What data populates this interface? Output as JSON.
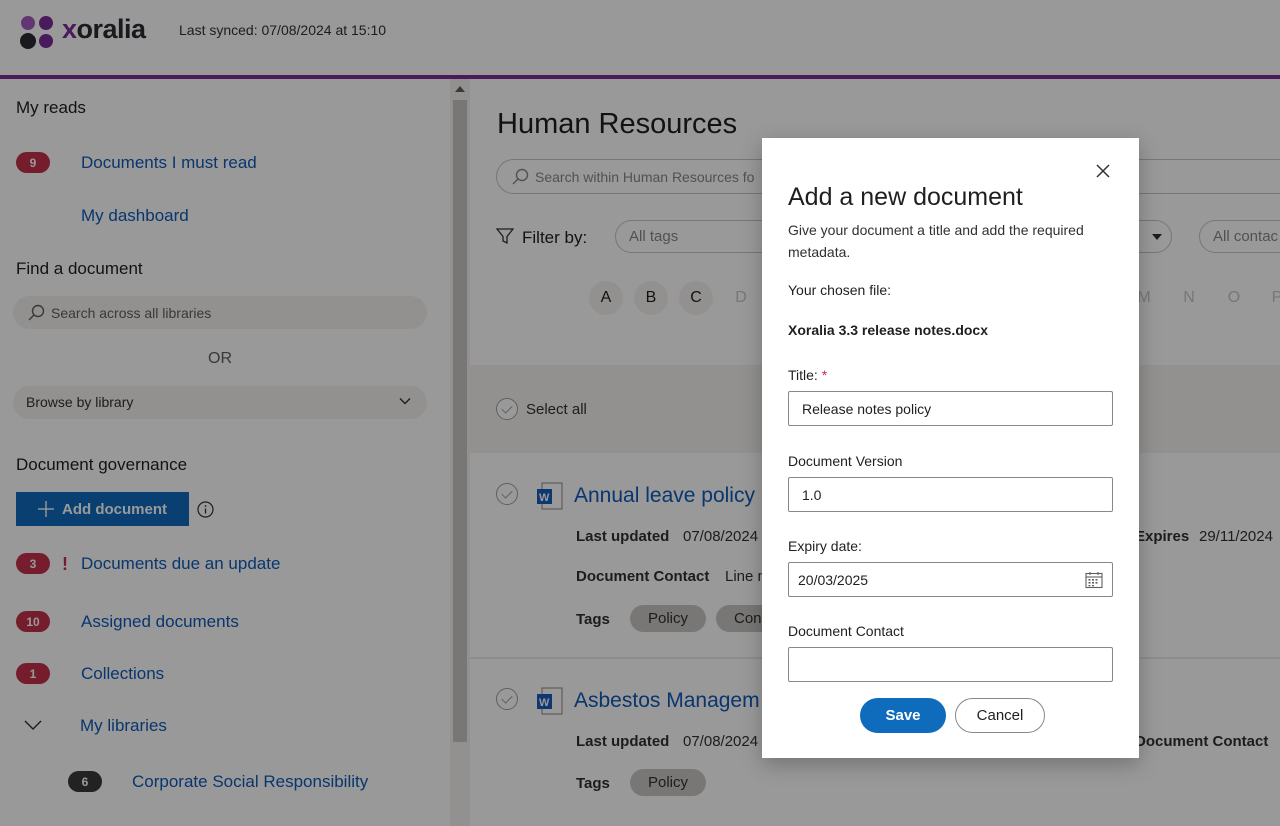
{
  "header": {
    "logo_text_a": "x",
    "logo_text_b": "oralia",
    "last_synced": "Last synced: 07/08/2024 at 15:10"
  },
  "sidebar": {
    "my_reads_title": "My reads",
    "must_read": {
      "count": "9",
      "label": "Documents I must read"
    },
    "dashboard_label": "My dashboard",
    "find_title": "Find a document",
    "search_placeholder": "Search across all libraries",
    "or_label": "OR",
    "browse_label": "Browse by library",
    "governance_title": "Document governance",
    "add_document_label": "Add document",
    "due_update": {
      "count": "3",
      "label": "Documents due an update"
    },
    "assigned": {
      "count": "10",
      "label": "Assigned documents"
    },
    "collections": {
      "count": "1",
      "label": "Collections"
    },
    "my_libraries_label": "My libraries",
    "csr": {
      "count": "6",
      "label": "Corporate Social Responsibility"
    }
  },
  "main": {
    "title": "Human Resources",
    "search_placeholder": "Search within Human Resources fo",
    "filter_label": "Filter by:",
    "tags_placeholder": "All tags",
    "contacts_placeholder": "All contac",
    "letters_on": [
      "A",
      "B",
      "C"
    ],
    "letters_off_left": [
      "D"
    ],
    "letters_off_right": [
      "M",
      "N",
      "O",
      "P"
    ],
    "select_all": "Select all",
    "documents": [
      {
        "title": "Annual leave policy",
        "last_updated_label": "Last updated",
        "last_updated": "07/08/2024",
        "expires_label": "Expires",
        "expires": "29/11/2024",
        "contact_label": "Document Contact",
        "contact": "Line m",
        "tags_label": "Tags",
        "tags": [
          "Policy",
          "Con"
        ]
      },
      {
        "title": "Asbestos Managem",
        "last_updated_label": "Last updated",
        "last_updated": "07/08/2024",
        "contact_label": "Document Contact",
        "tags_label": "Tags",
        "tags": [
          "Policy"
        ]
      }
    ]
  },
  "modal": {
    "title": "Add a new document",
    "subtitle": "Give your document a title and add the required metadata.",
    "chosen_file_label": "Your chosen file:",
    "chosen_file": "Xoralia 3.3 release notes.docx",
    "title_label": "Title:",
    "required_mark": "*",
    "title_value": "Release notes policy",
    "version_label": "Document Version",
    "version_value": "1.0",
    "expiry_label": "Expiry date:",
    "expiry_value": "20/03/2025",
    "contact_label": "Document Contact",
    "contact_value": "",
    "save_label": "Save",
    "cancel_label": "Cancel"
  },
  "colors": {
    "brand_purple": "#7a2e9b",
    "primary_blue": "#0f6cbd",
    "link_blue": "#0f5ab8",
    "badge_red": "#c4314b"
  },
  "icons": [
    "logo-icon",
    "search-icon",
    "chevron-down-icon",
    "plus-icon",
    "info-icon",
    "exclamation-icon",
    "filter-icon",
    "check-circle-icon",
    "word-doc-icon",
    "close-icon",
    "calendar-icon"
  ]
}
